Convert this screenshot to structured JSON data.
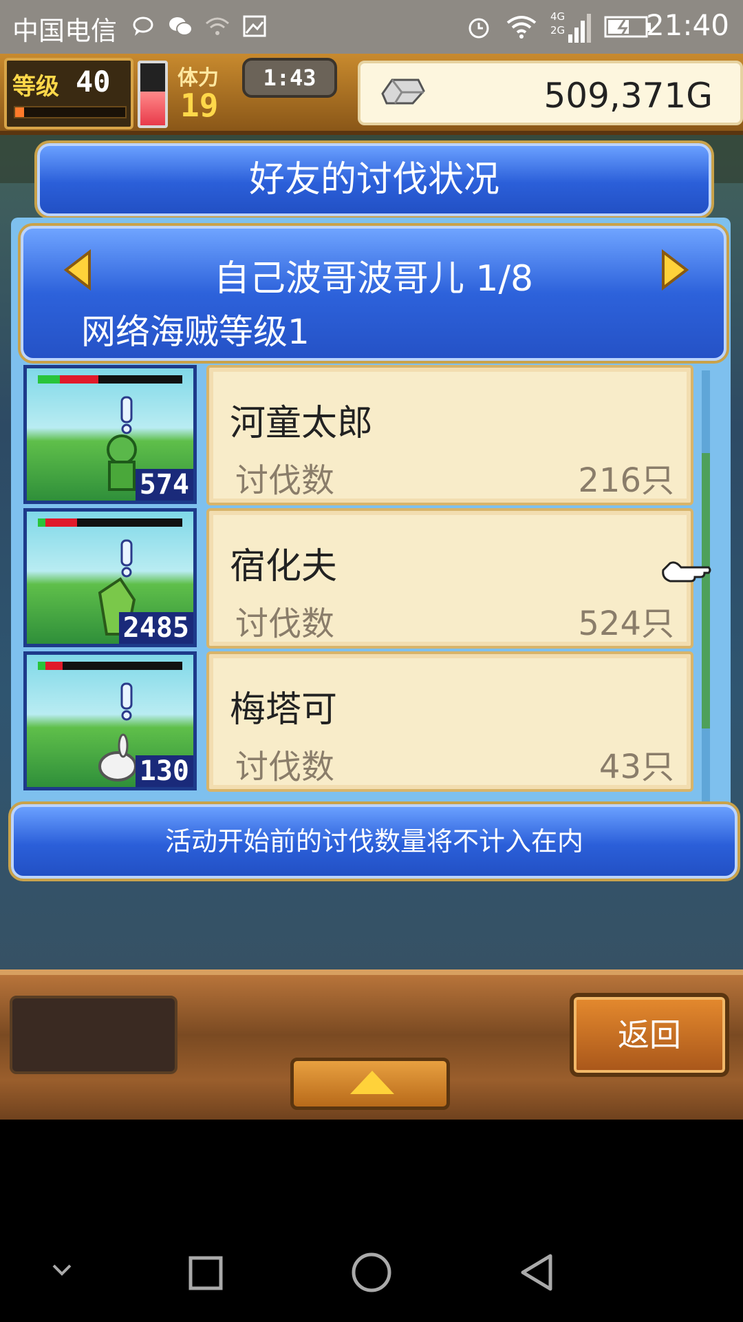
{
  "status_bar": {
    "carrier": "中国电信",
    "network": "4G 2G",
    "time": "21:40"
  },
  "hud": {
    "level_label": "等级",
    "level_value": "40",
    "level_progress": 0.08,
    "stamina_label": "体力",
    "stamina_value": "19",
    "stamina_fill": 0.55,
    "timer": "1:43",
    "gold": "509,371G"
  },
  "dialog": {
    "title": "好友的讨伐状况",
    "friend_name": "自己波哥波哥儿 1/8",
    "friend_rank": "网络海贼等级1",
    "rows": [
      {
        "name": "河童太郎",
        "label": "讨伐数",
        "value": "216只",
        "badge": "574",
        "hp_green": 0.15,
        "hp_red": 0.27
      },
      {
        "name": "宿化夫",
        "label": "讨伐数",
        "value": "524只",
        "badge": "2485",
        "hp_green": 0.05,
        "hp_red": 0.22
      },
      {
        "name": "梅塔可",
        "label": "讨伐数",
        "value": "43只",
        "badge": "130",
        "hp_green": 0.05,
        "hp_red": 0.12
      }
    ],
    "notice": "活动开始前的讨伐数量将不计入在内"
  },
  "bottom": {
    "back_label": "返回"
  },
  "icons": {
    "status": [
      "message-icon",
      "wechat-icon",
      "wifi-question-icon",
      "image-icon",
      "alarm-icon",
      "wifi-icon",
      "signal-icon",
      "battery-icon"
    ],
    "nav": [
      "chevron-down-icon",
      "recents-icon",
      "home-icon",
      "back-icon"
    ]
  },
  "colors": {
    "panel_blue": "#2b5fd9",
    "card_cream": "#f8ecc9",
    "wood": "#9a5e2c"
  }
}
